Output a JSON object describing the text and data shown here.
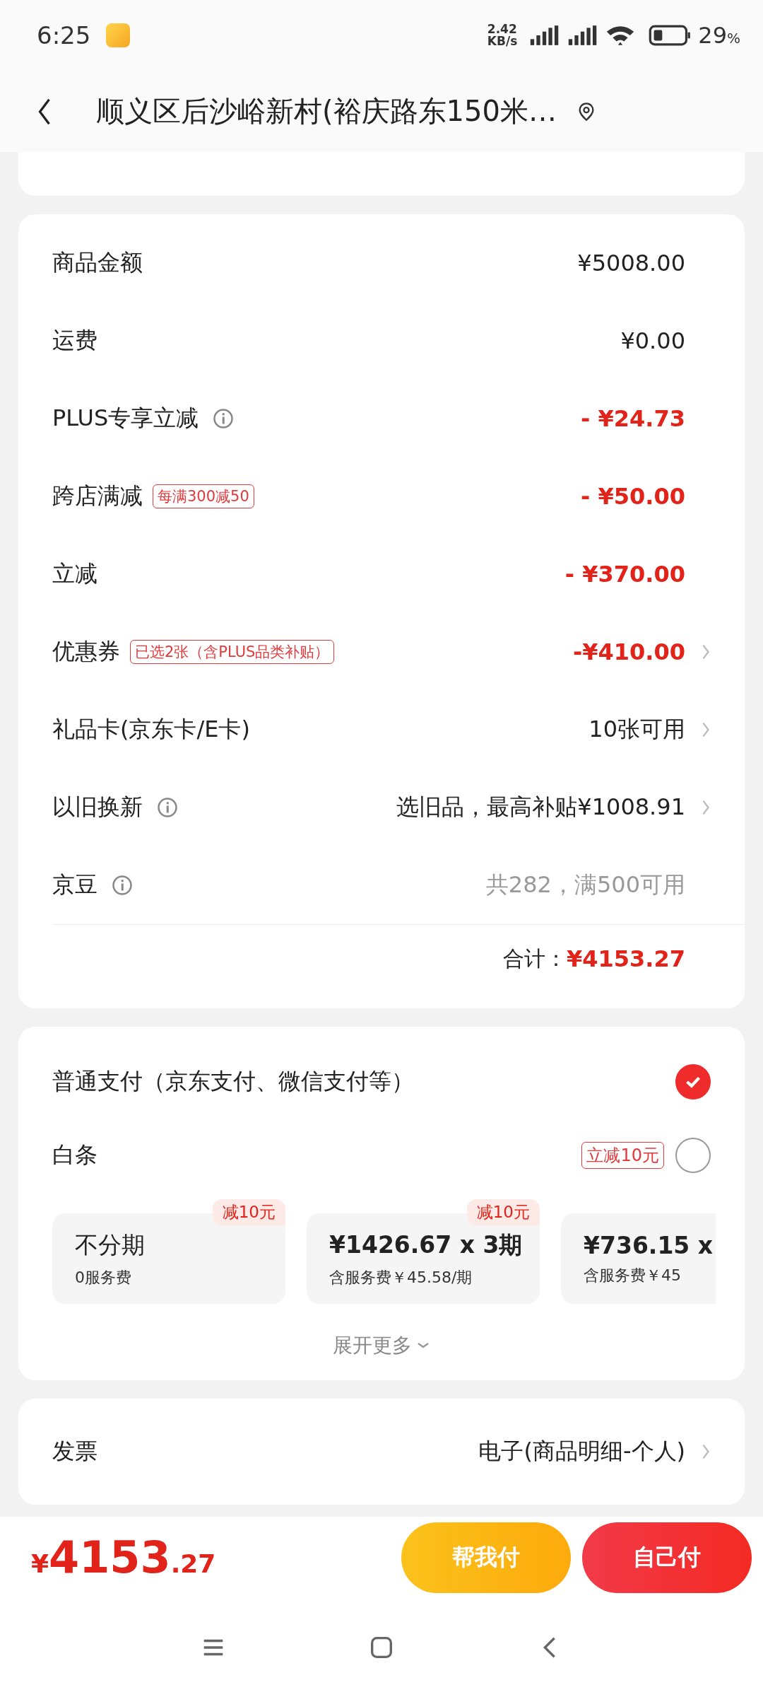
{
  "status_bar": {
    "time": "6:25",
    "net_speed_value": "2.42",
    "net_speed_unit": "KB/s",
    "battery": "29",
    "battery_unit": "%"
  },
  "header": {
    "title": "顺义区后沙峪新村(裕庆路东150米…"
  },
  "summary": {
    "rows": [
      {
        "label": "商品金额",
        "info": false,
        "value": "¥5008.00",
        "kind": "plain",
        "chevron": false
      },
      {
        "label": "运费",
        "info": false,
        "value": "¥0.00",
        "kind": "plain",
        "chevron": false
      },
      {
        "label": "PLUS专享立减",
        "info": true,
        "value": "- ¥24.73",
        "kind": "discount",
        "chevron": false
      },
      {
        "label": "跨店满减",
        "info": false,
        "tag": "每满300减50",
        "value": "- ¥50.00",
        "kind": "discount",
        "chevron": false
      },
      {
        "label": "立减",
        "info": false,
        "value": "- ¥370.00",
        "kind": "discount",
        "chevron": false
      },
      {
        "label": "优惠券",
        "info": false,
        "tag": "已选2张（含PLUS品类补贴）",
        "value": "-¥410.00",
        "kind": "discount",
        "chevron": true
      },
      {
        "label": "礼品卡(京东卡/E卡)",
        "info": false,
        "value": "10张可用",
        "kind": "plain",
        "chevron": true
      },
      {
        "label": "以旧换新",
        "info": true,
        "value": "选旧品，最高补贴¥1008.91",
        "kind": "plain",
        "chevron": true
      },
      {
        "label": "京豆",
        "info": true,
        "value": "共282，满500可用",
        "kind": "muted",
        "chevron": false
      }
    ],
    "total_label": "合计：",
    "total_value": "¥4153.27"
  },
  "payment": {
    "options": [
      {
        "label": "普通支付（京东支付、微信支付等）",
        "selected": true
      },
      {
        "label": "白条",
        "tag": "立减10元",
        "selected": false
      }
    ],
    "plans": [
      {
        "title": "不分期",
        "subtitle": "0服务费",
        "badge": "减10元"
      },
      {
        "title": "¥1426.67 x 3期",
        "subtitle": "含服务费￥45.58/期",
        "badge": "减10元"
      },
      {
        "title": "¥736.15 x",
        "subtitle": "含服务费￥45"
      }
    ],
    "expand": "展开更多"
  },
  "invoice": {
    "label": "发票",
    "value": "电子(商品明细-个人)"
  },
  "footer": {
    "currency": "¥",
    "amount": "4153",
    "cents": ".27",
    "buttons": [
      {
        "label": "帮我付",
        "kind": "secondary"
      },
      {
        "label": "自己付",
        "kind": "primary"
      }
    ]
  }
}
